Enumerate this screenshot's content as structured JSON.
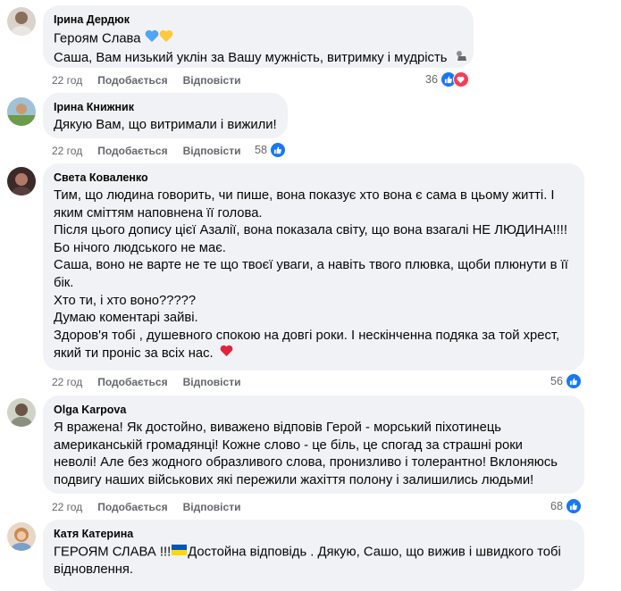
{
  "actions": {
    "like": "Подобається",
    "reply": "Відповісти"
  },
  "comments": [
    {
      "author": "Ірина Дердюк",
      "lines": [
        "Героям Слава",
        "Саша, Вам низький уклін за Вашу мужність, витримку і мудрість"
      ],
      "time": "22 год",
      "reactions": "36",
      "icons": [
        "like-icon",
        "love-icon"
      ]
    },
    {
      "author": "Ірина Книжник",
      "lines": [
        "Дякую Вам, що витримали і вижили!"
      ],
      "time": "22 год",
      "reactions": "58",
      "icons": [
        "like-icon"
      ]
    },
    {
      "author": "Света Коваленко",
      "lines": [
        "Тим, що людина говорить, чи пише, вона показує хто вона є сама в цьому житті. І",
        "яким сміттям наповнена її голова.",
        "Після цього допису цієї Азалії, вона показала світу, що вона взагалі НЕ ЛЮДИНА!!!!",
        "Бо нічого людського не має.",
        "Саша, воно не варте не те що твоєї уваги, а навіть твого плювка, щоби плюнути в її",
        "бік.",
        "Хто ти, і хто воно?????",
        "Думаю коментарі зайві.",
        "Здоров'я тобі , душевного спокою на довгі роки. І нескінченна подяка за той хрест,",
        "який ти проніс за всіх нас."
      ],
      "time": "22 год",
      "reactions": "56",
      "icons": [
        "like-icon"
      ]
    },
    {
      "author": "Olga Karpova",
      "lines": [
        "Я вражена! Як достойно, виважено відповів Герой - морський піхотинець",
        "американській громадянці! Кожне слово - це біль, це спогад за страшні роки",
        "неволі! Але без жодного образливого слова, пронизливо і толерантно! Вклоняюсь",
        "подвигу наших військових які пережили жахіття полону і залишились людьми!"
      ],
      "time": "22 год",
      "reactions": "68",
      "icons": [
        "like-icon"
      ]
    },
    {
      "author": "Катя Катерина",
      "lines": [
        "ГЕРОЯМ СЛАВА !!!",
        "Достойна відповідь . Дякую, Сашо, що вижив і швидкого тобі",
        "відновлення."
      ]
    }
  ],
  "colors": {
    "like": "#1877f2",
    "love": "#f33e58",
    "bubble": "#f0f2f5",
    "meta": "#65676b"
  }
}
